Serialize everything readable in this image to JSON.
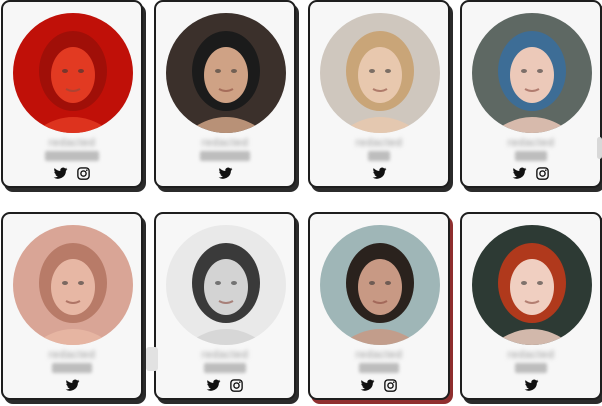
{
  "cards": [
    {
      "id": "c1",
      "name": "redacted",
      "sub_width": 54,
      "twitter": true,
      "instagram": true,
      "highlight": false,
      "bg": "#c01008",
      "skin": "#e23a22",
      "hair": "#a00f08"
    },
    {
      "id": "c2",
      "name": "redacted",
      "sub_width": 50,
      "twitter": true,
      "instagram": false,
      "highlight": false,
      "bg": "#3b302b",
      "skin": "#cfa285",
      "hair": "#1b1b1b"
    },
    {
      "id": "c3",
      "name": "redacted",
      "sub_width": 22,
      "twitter": true,
      "instagram": false,
      "highlight": false,
      "bg": "#cfc7be",
      "skin": "#e8c8ae",
      "hair": "#c9a578"
    },
    {
      "id": "c4",
      "name": "redacted",
      "sub_width": 32,
      "twitter": true,
      "instagram": true,
      "highlight": false,
      "bg": "#5e6863",
      "skin": "#ecc9b9",
      "hair": "#3d6d96"
    },
    {
      "id": "c5",
      "name": "redacted",
      "sub_width": 40,
      "twitter": true,
      "instagram": false,
      "highlight": false,
      "bg": "#d9a596",
      "skin": "#e7b7a4",
      "hair": "#b87b68"
    },
    {
      "id": "c6",
      "name": "redacted",
      "sub_width": 42,
      "twitter": true,
      "instagram": true,
      "highlight": false,
      "bg": "#e9e9e9",
      "skin": "#d3d3d3",
      "hair": "#3a3a3a"
    },
    {
      "id": "c7",
      "name": "redacted",
      "sub_width": 40,
      "twitter": true,
      "instagram": true,
      "highlight": true,
      "bg": "#9fb6b7",
      "skin": "#c89984",
      "hair": "#2a221d"
    },
    {
      "id": "c8",
      "name": "redacted",
      "sub_width": 32,
      "twitter": true,
      "instagram": false,
      "highlight": false,
      "bg": "#2d3a34",
      "skin": "#f0cfc1",
      "hair": "#b0391c"
    }
  ],
  "colors": {
    "card_border": "#1e1e1e",
    "card_bg": "#f7f7f7",
    "icon": "#111111"
  },
  "icons": {
    "twitter": "twitter-icon",
    "instagram": "instagram-icon"
  }
}
